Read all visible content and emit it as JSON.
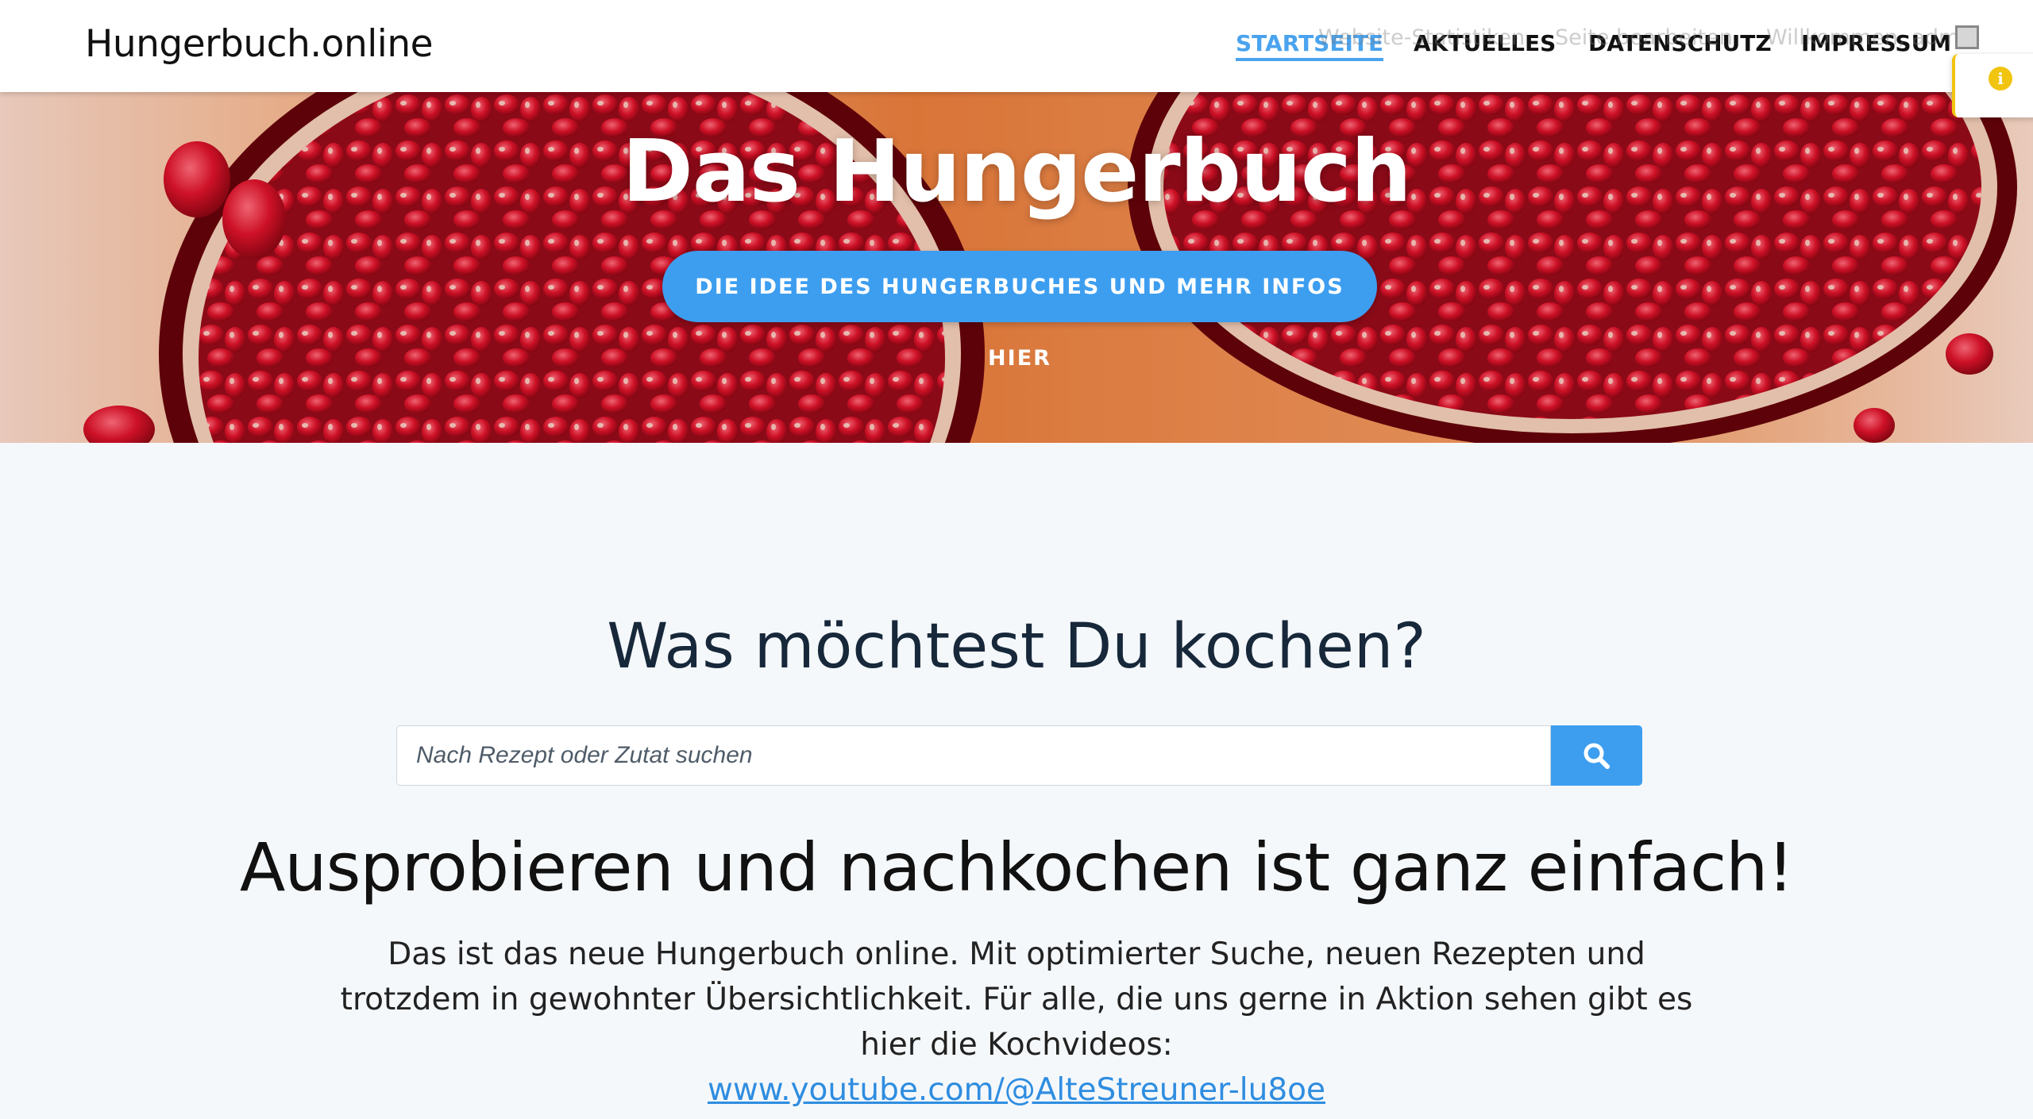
{
  "header": {
    "brand": "Hungerbuch.online",
    "nav": [
      {
        "label": "STARTSEITE",
        "active": true
      },
      {
        "label": "AKTUELLES",
        "active": false
      },
      {
        "label": "DATENSCHUTZ",
        "active": false
      },
      {
        "label": "IMPRESSUM",
        "active": false
      }
    ],
    "admin_bar": [
      "Website-Statistiken",
      "Seite bearbeiten",
      "Willkommen, admin"
    ],
    "notice_icon": "info-icon"
  },
  "hero": {
    "title": "Das Hungerbuch",
    "button_label": "DIE IDEE DES HUNGERBUCHES UND MEHR INFOS HIER",
    "background": "pomegranate-photo"
  },
  "search": {
    "heading": "Was möchtest Du kochen?",
    "placeholder": "Nach Rezept oder Zutat suchen",
    "value": "",
    "button_icon": "search-icon"
  },
  "intro": {
    "heading": "Ausprobieren und nachkochen ist ganz einfach!",
    "text": "Das ist das neue Hungerbuch online. Mit optimierter Suche, neuen Rezepten und trotzdem in gewohnter Übersichtlichkeit. Für alle, die uns gerne in Aktion sehen gibt es hier die Kochvideos:",
    "link_text": "www.youtube.com/@AlteStreuner-lu8oe"
  },
  "colors": {
    "accent": "#3d9ef0",
    "page_bg": "#f5f8fb",
    "notice": "#f1c40f"
  }
}
